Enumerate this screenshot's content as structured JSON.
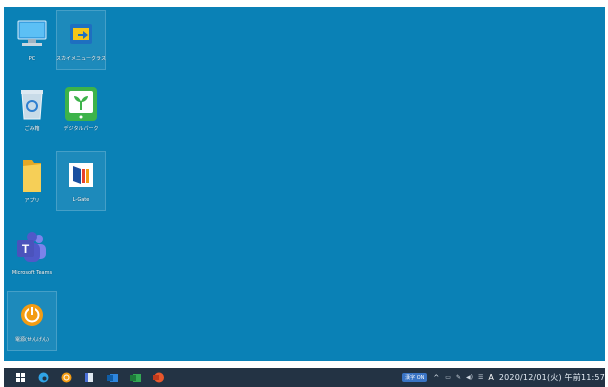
{
  "desktop": {
    "background": "#0a81b6",
    "icons": [
      {
        "label": "PC",
        "icon": "pc-icon"
      },
      {
        "label": "スカイメニュークラス",
        "icon": "sky-menu-icon"
      },
      {
        "label": "ごみ箱",
        "icon": "recycle-bin-icon"
      },
      {
        "label": "デジタルパーク",
        "icon": "digital-park-icon"
      },
      {
        "label": "アプリ",
        "icon": "folder-icon"
      },
      {
        "label": "L-Gate",
        "icon": "l-gate-icon"
      },
      {
        "label": "Microsoft Teams",
        "icon": "teams-icon"
      },
      {
        "label": "電源(せんげん)",
        "icon": "power-icon"
      }
    ]
  },
  "taskbar": {
    "background": "#233344",
    "icons": [
      "windows-start-icon",
      "edge-icon",
      "app-orange-icon",
      "notes-icon",
      "outlook-icon",
      "excel-icon",
      "powerpoint-icon"
    ],
    "tray": {
      "ime_label": "漢字 ON",
      "chevron": "^",
      "network": "▭",
      "pen": "✎",
      "volume": "◀)",
      "keyboard": "☰",
      "input_mode": "A",
      "clock": "2020/12/01(火) 午前11:57"
    }
  }
}
